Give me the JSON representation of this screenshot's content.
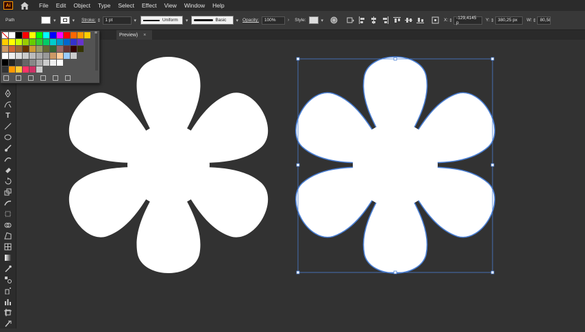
{
  "app": {
    "logo_text": "Ai"
  },
  "menu": [
    "File",
    "Edit",
    "Object",
    "Type",
    "Select",
    "Effect",
    "View",
    "Window",
    "Help"
  ],
  "control_bar": {
    "selection_label": "Path",
    "fill_color": "#ffffff",
    "stroke_label": "Stroke:",
    "stroke_weight": "1 pt",
    "profile_label": "Uniform",
    "brush_label": "Basic",
    "opacity_label": "Opacity:",
    "opacity_value": "100%",
    "style_label": "Style:",
    "x_label": "X:",
    "x_value": "-129,4145 p",
    "y_label": "Y:",
    "y_value": "380,25 px",
    "w_label": "W:",
    "w_value": "80,58"
  },
  "document": {
    "tab_label": "Preview)",
    "close_glyph": "×"
  },
  "tools": [
    "selection-tool",
    "direct-selection-tool",
    "magic-wand-tool",
    "lasso-tool",
    "pen-tool",
    "curvature-tool",
    "type-tool",
    "line-tool",
    "ellipse-tool",
    "paintbrush-tool",
    "shaper-tool",
    "eraser-tool",
    "rotate-tool",
    "scale-tool",
    "warp-tool",
    "free-transform-tool",
    "shape-builder-tool",
    "perspective-tool",
    "mesh-tool",
    "gradient-tool",
    "eyedropper-tool",
    "blend-tool",
    "symbol-sprayer-tool",
    "column-graph-tool",
    "artboard-tool",
    "slice-tool"
  ],
  "swatches": {
    "rows": [
      [
        "none",
        "#ffffff",
        "#000000",
        "#ff0000",
        "#ffff00",
        "#00ff00",
        "#00ffff",
        "#0000ff",
        "#ff00ff",
        "#ff0000",
        "#ff6600",
        "#ff9900",
        "#ffcc00"
      ],
      [
        "#ffcc00",
        "#ffff00",
        "#ccff00",
        "#99cc00",
        "#66cc00",
        "#33cc33",
        "#00cc66",
        "#00cccc",
        "#0099cc",
        "#0066cc",
        "#3333cc",
        "#6633cc"
      ],
      [
        "#cc9966",
        "#cc6633",
        "#996633",
        "#663300",
        "#cc9933",
        "#999966",
        "#666633",
        "#336633",
        "#996666",
        "#663333",
        "#330000",
        "#333300"
      ],
      [
        "#ffffff",
        "#eeeeee",
        "#dddddd",
        "#cccccc",
        "#bbbbbb",
        "#aaaaaa",
        "#999999",
        "#cc9966",
        "#ffcc99",
        "#99ccff",
        "#cccccc"
      ],
      [
        "#000000",
        "#222222",
        "#444444",
        "#666666",
        "#888888",
        "#aaaaaa",
        "#cccccc",
        "#eeeeee",
        "#ffffff"
      ],
      [
        "#333333",
        "#ff9900",
        "#ffcc33",
        "#ff3366",
        "#cc3366",
        "#cccccc"
      ]
    ]
  },
  "colors": {
    "accent": "#4a7fd4",
    "canvas": "#323232",
    "shape_fill": "#ffffff"
  }
}
